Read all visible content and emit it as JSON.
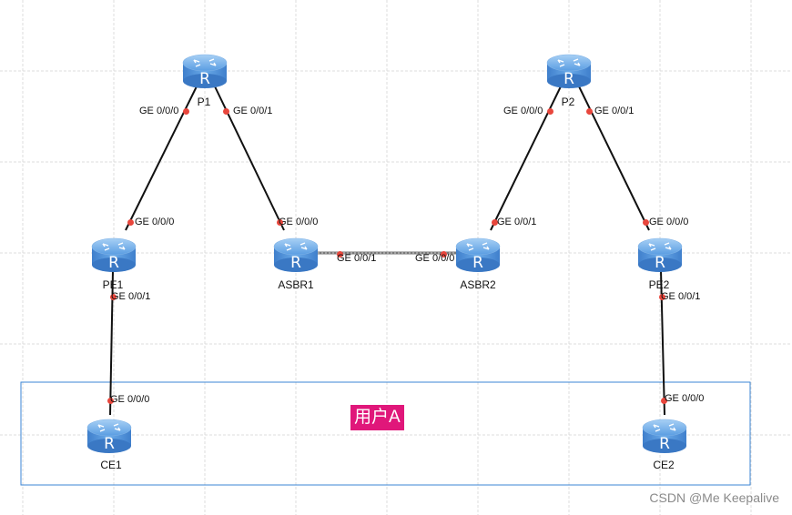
{
  "colors": {
    "router": "#4f8fd6",
    "port_dot": "#e8463c",
    "link": "#111111",
    "ebgp_link": "#777777",
    "group_border": "#3b86d4",
    "tag_bg": "#e0177a"
  },
  "routers": [
    {
      "id": "P1",
      "label": "P1"
    },
    {
      "id": "P2",
      "label": "P2"
    },
    {
      "id": "PE1",
      "label": "PE1"
    },
    {
      "id": "ASBR1",
      "label": "ASBR1"
    },
    {
      "id": "ASBR2",
      "label": "ASBR2"
    },
    {
      "id": "PE2",
      "label": "PE2"
    },
    {
      "id": "CE1",
      "label": "CE1"
    },
    {
      "id": "CE2",
      "label": "CE2"
    }
  ],
  "router_glyph": "R",
  "router_icon": "router-icon",
  "ports": [
    {
      "id": "p1-ge000",
      "label": "GE 0/0/0"
    },
    {
      "id": "p1-ge001",
      "label": "GE 0/0/1"
    },
    {
      "id": "pe1-ge000",
      "label": "GE 0/0/0"
    },
    {
      "id": "asbr1-ge000",
      "label": "GE 0/0/0"
    },
    {
      "id": "pe1-ge001",
      "label": "GE 0/0/1"
    },
    {
      "id": "asbr1-ge001",
      "label": "GE 0/0/1"
    },
    {
      "id": "ce1-ge000",
      "label": "GE 0/0/0"
    },
    {
      "id": "p2-ge000",
      "label": "GE 0/0/0"
    },
    {
      "id": "p2-ge001",
      "label": "GE 0/0/1"
    },
    {
      "id": "asbr2-ge001",
      "label": "GE 0/0/1"
    },
    {
      "id": "pe2-ge000",
      "label": "GE 0/0/0"
    },
    {
      "id": "asbr2-ge000",
      "label": "GE 0/0/0"
    },
    {
      "id": "pe2-ge001",
      "label": "GE 0/0/1"
    },
    {
      "id": "ce2-ge000",
      "label": "GE 0/0/0"
    }
  ],
  "links": [
    {
      "from": "P1",
      "to": "PE1"
    },
    {
      "from": "P1",
      "to": "ASBR1"
    },
    {
      "from": "PE1",
      "to": "CE1"
    },
    {
      "from": "ASBR1",
      "to": "ASBR2",
      "style": "ebgp"
    },
    {
      "from": "P2",
      "to": "ASBR2"
    },
    {
      "from": "P2",
      "to": "PE2"
    },
    {
      "from": "PE2",
      "to": "CE2"
    }
  ],
  "group_tag": "用户A",
  "watermark": "CSDN @Me Keepalive"
}
